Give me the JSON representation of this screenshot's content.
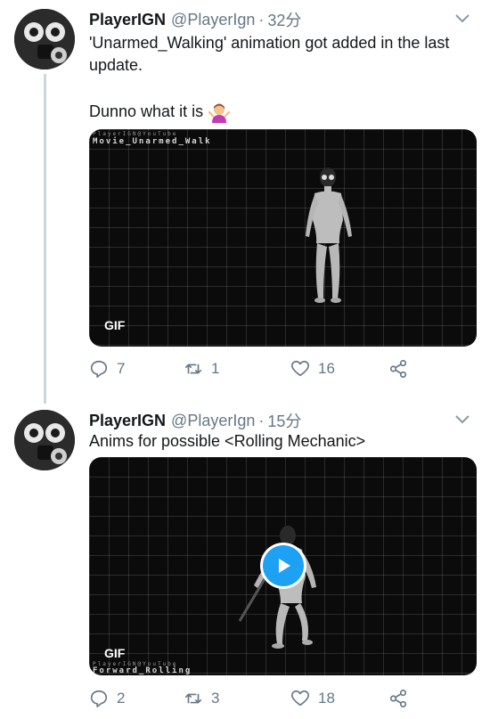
{
  "tweets": [
    {
      "name": "PlayerIGN",
      "handle": "@PlayerIgn",
      "separator": "·",
      "time": "32分",
      "text_line1": "'Unarmed_Walking' animation got added in the last update.",
      "text_line2": "Dunno what it is",
      "emoji": "woman-shrugging-icon",
      "media": {
        "watermark_top": "PlayerIGN@YouTube",
        "watermark_title": "Movie_Unarmed_Walk",
        "badge": "GIF"
      },
      "replies": "7",
      "retweets": "1",
      "likes": "16"
    },
    {
      "name": "PlayerIGN",
      "handle": "@PlayerIgn",
      "separator": "·",
      "time": "15分",
      "text_line1": "Anims for possible <Rolling Mechanic>",
      "media": {
        "watermark_top": "PlayerIGN@YouTube",
        "watermark_title": "Forward_Rolling",
        "badge": "GIF"
      },
      "replies": "2",
      "retweets": "3",
      "likes": "18"
    }
  ],
  "colors": {
    "text": "#14171a",
    "secondary": "#657786",
    "accent": "#1da1f2",
    "thread_line": "#ccd6dd",
    "media_bg": "#0b0b0b"
  }
}
